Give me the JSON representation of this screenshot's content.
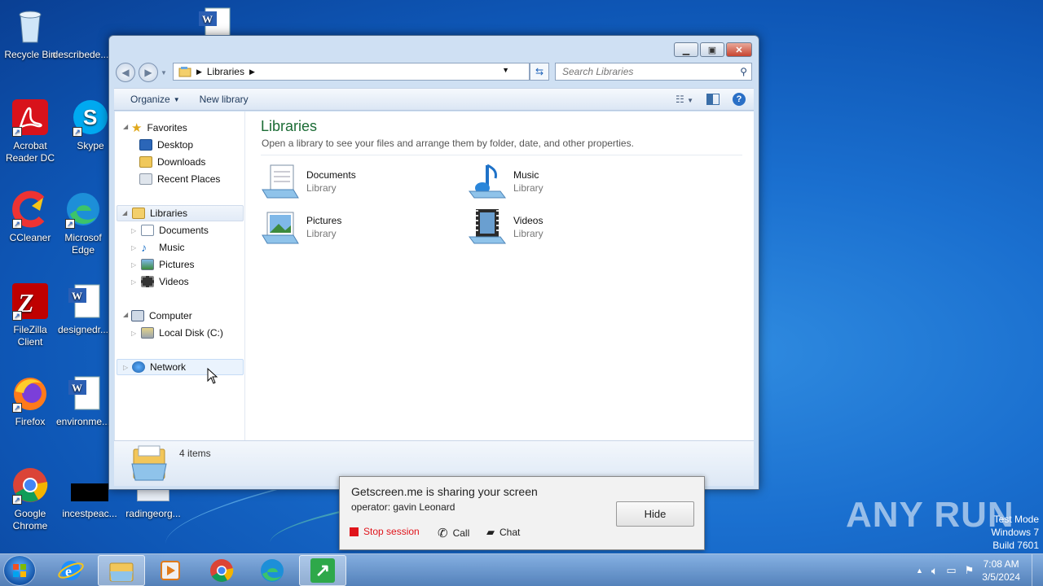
{
  "desktop": {
    "icons": [
      {
        "label": "Recycle Bin",
        "icon": "recycle-bin-icon"
      },
      {
        "label": "describede...",
        "icon": "word-doc-icon"
      },
      {
        "label": "Acrobat\nReader DC",
        "icon": "acrobat-icon"
      },
      {
        "label": "Skype",
        "icon": "skype-icon"
      },
      {
        "label": "CCleaner",
        "icon": "ccleaner-icon"
      },
      {
        "label": "Microsof\nEdge",
        "icon": "edge-icon"
      },
      {
        "label": "FileZilla\nClient",
        "icon": "filezilla-icon"
      },
      {
        "label": "designedr...",
        "icon": "word-doc-icon"
      },
      {
        "label": "Firefox",
        "icon": "firefox-icon"
      },
      {
        "label": "environme...",
        "icon": "word-doc-icon"
      },
      {
        "label": "Google\nChrome",
        "icon": "chrome-icon"
      },
      {
        "label": "incestpeac...",
        "icon": "black-file-icon"
      },
      {
        "label": "radingeorg...",
        "icon": "file-icon"
      }
    ]
  },
  "window": {
    "address": {
      "crumb": "Libraries"
    },
    "search": {
      "placeholder": "Search Libraries"
    },
    "toolbar": {
      "organize": "Organize",
      "new_library": "New library"
    },
    "nav": {
      "favorites": "Favorites",
      "favorites_items": [
        "Desktop",
        "Downloads",
        "Recent Places"
      ],
      "libraries": "Libraries",
      "libraries_items": [
        "Documents",
        "Music",
        "Pictures",
        "Videos"
      ],
      "computer": "Computer",
      "computer_items": [
        "Local Disk (C:)"
      ],
      "network": "Network"
    },
    "main": {
      "title": "Libraries",
      "description": "Open a library to see your files and arrange them by folder, date, and other properties.",
      "libraries": [
        {
          "name": "Documents",
          "type": "Library"
        },
        {
          "name": "Music",
          "type": "Library"
        },
        {
          "name": "Pictures",
          "type": "Library"
        },
        {
          "name": "Videos",
          "type": "Library"
        }
      ]
    },
    "status": {
      "count": "4 items"
    }
  },
  "getscreen": {
    "title": "Getscreen.me is sharing your screen",
    "operator": "operator: gavin Leonard",
    "hide": "Hide",
    "stop": "Stop session",
    "call": "Call",
    "chat": "Chat",
    "colors": {
      "stop": "#e0141b"
    }
  },
  "watermark": {
    "brand": "ANY RUN",
    "test_mode": "Test Mode",
    "os": "Windows 7",
    "build": "Build 7601"
  },
  "taskbar": {
    "apps": [
      "internet-explorer-icon",
      "explorer-icon",
      "media-player-icon",
      "chrome-icon",
      "edge-icon",
      "getscreen-icon"
    ],
    "clock": {
      "time": "7:08 AM",
      "date": "3/5/2024"
    }
  }
}
